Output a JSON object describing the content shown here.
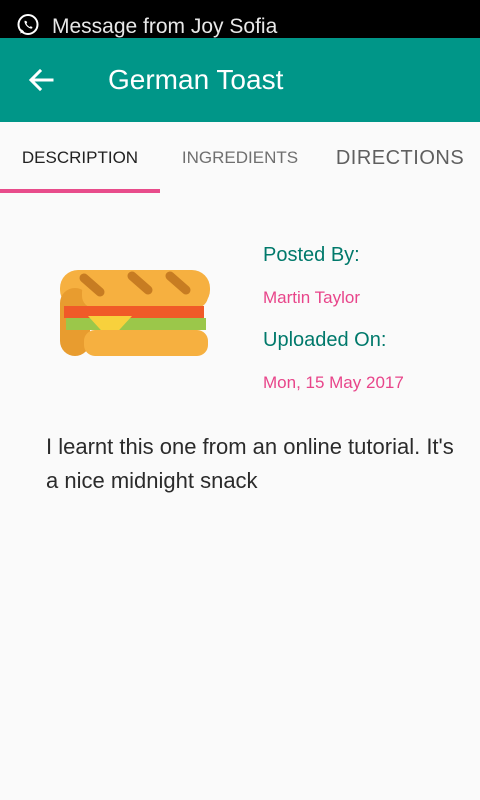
{
  "status_bar": {
    "notification_icon": "whatsapp-icon",
    "notification_text": "Message from Joy Sofia"
  },
  "app_bar": {
    "back_icon": "arrow-back-icon",
    "title": "German Toast"
  },
  "tabs": [
    {
      "label": "DESCRIPTION",
      "selected": true
    },
    {
      "label": "INGREDIENTS",
      "selected": false
    },
    {
      "label": "DIRECTIONS",
      "selected": false
    }
  ],
  "recipe": {
    "image_icon": "sandwich-icon",
    "posted_by_label": "Posted By:",
    "posted_by_value": "Martin Taylor",
    "uploaded_on_label": "Uploaded On:",
    "uploaded_on_value": "Mon, 15 May 2017",
    "description": "I learnt this one from an online tutorial. It's a nice midnight snack"
  },
  "colors": {
    "primary": "#009688",
    "accent": "#e84c8b",
    "label_text": "#00796b"
  }
}
